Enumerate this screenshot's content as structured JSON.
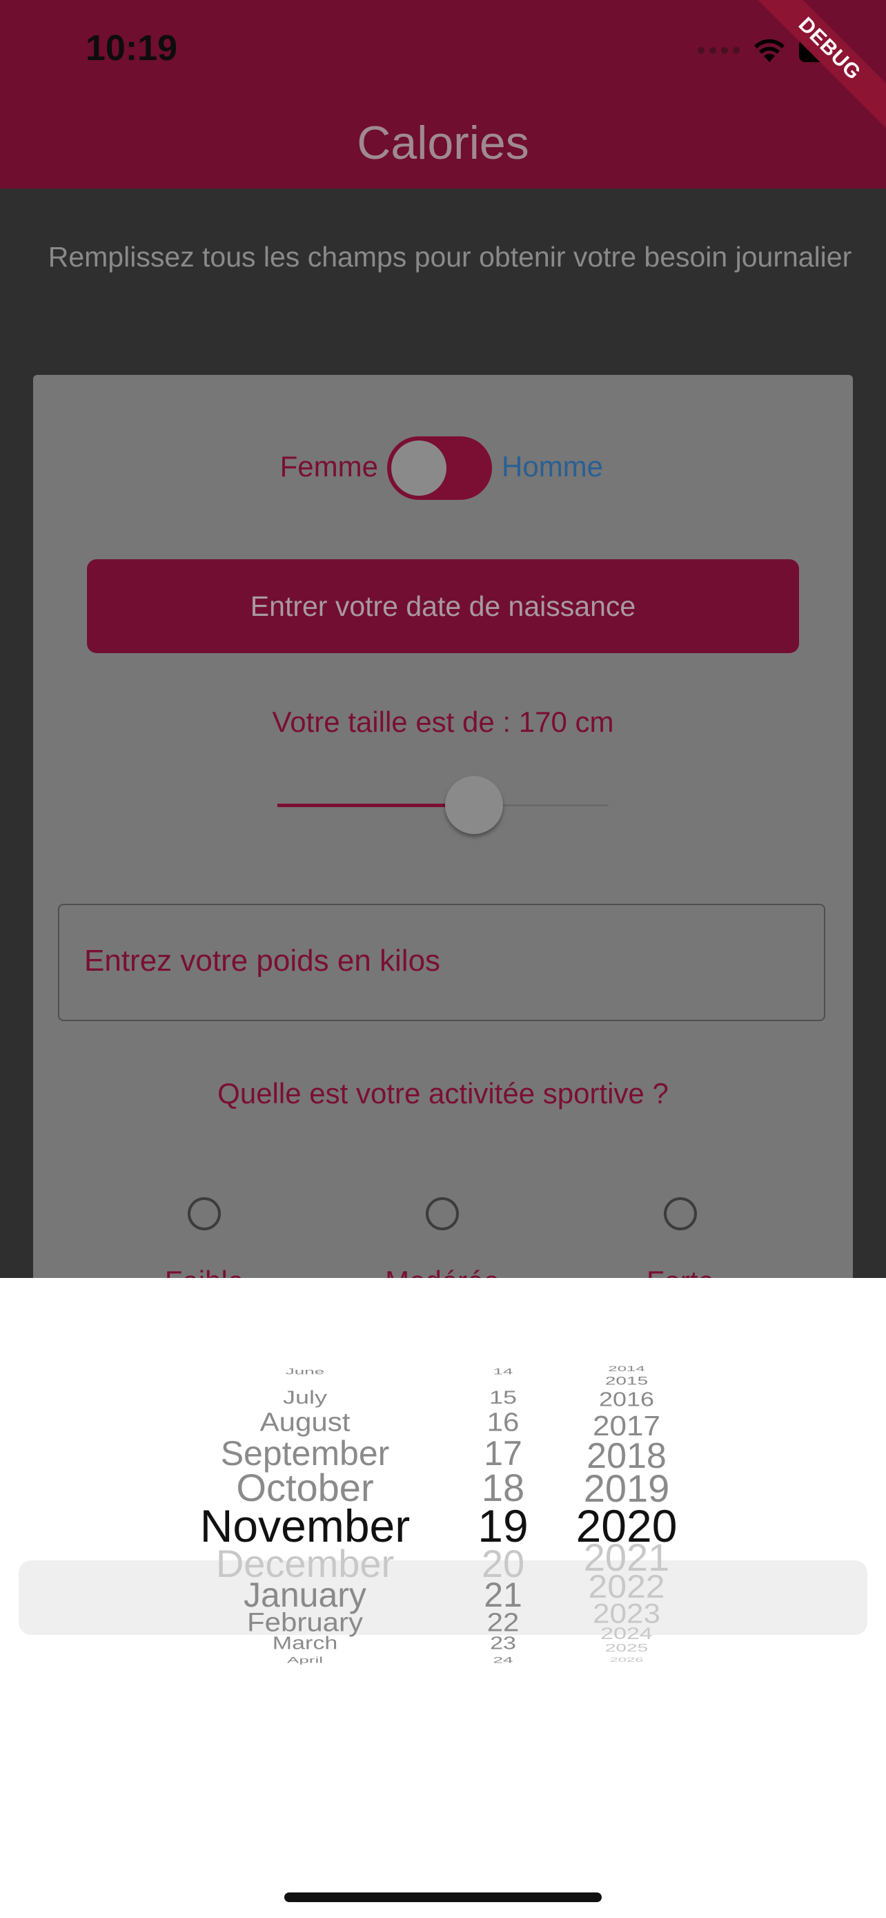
{
  "status_bar": {
    "time": "10:19"
  },
  "app_bar": {
    "title": "Calories",
    "debug_banner": "DEBUG"
  },
  "intro_text": "Remplissez tous les champs pour obtenir votre besoin journalier",
  "form": {
    "gender_female": "Femme",
    "gender_male": "Homme",
    "date_button": "Entrer votre date de naissance",
    "height_label": "Votre taille est de : 170 cm",
    "height_cm": 170,
    "weight_placeholder": "Entrez votre poids en kilos",
    "activity_question": "Quelle est votre activitée sportive ?",
    "activity_options": [
      "Faible",
      "Modérée",
      "Forte"
    ]
  },
  "date_picker": {
    "months": [
      "June",
      "July",
      "August",
      "September",
      "October",
      "November",
      "December",
      "January",
      "February",
      "March",
      "April"
    ],
    "days": [
      "14",
      "15",
      "16",
      "17",
      "18",
      "19",
      "20",
      "21",
      "22",
      "23",
      "24"
    ],
    "years": [
      "2014",
      "2015",
      "2016",
      "2017",
      "2018",
      "2019",
      "2020",
      "2021",
      "2022",
      "2023",
      "2024",
      "2025",
      "2026"
    ],
    "selected_month": "November",
    "selected_day": "19",
    "selected_year": "2020"
  },
  "colors": {
    "primary": "#6f0e2f",
    "accent_text": "#7a0f33",
    "male_label": "#2a5f93"
  }
}
